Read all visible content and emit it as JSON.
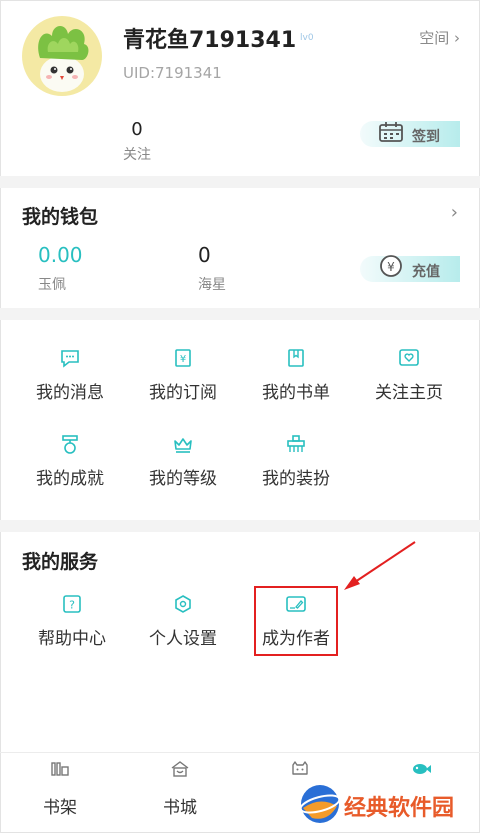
{
  "profile": {
    "username": "青花鱼7191341",
    "level_badge": "lv0",
    "uid": "UID:7191341",
    "space_label": "空间 ›",
    "follow_count": "0",
    "follow_label": "关注",
    "checkin_label": "签到"
  },
  "wallet": {
    "title": "我的钱包",
    "yupei_value": "0.00",
    "yupei_label": "玉佩",
    "haixing_value": "0",
    "haixing_label": "海星",
    "recharge_label": "充值"
  },
  "menu": {
    "messages": "我的消息",
    "subscriptions": "我的订阅",
    "booklists": "我的书单",
    "follow_home": "关注主页",
    "achievements": "我的成就",
    "level": "我的等级",
    "dress_up": "我的装扮"
  },
  "services": {
    "title": "我的服务",
    "help": "帮助中心",
    "settings": "个人设置",
    "become_author": "成为作者"
  },
  "nav": {
    "bookshelf": "书架",
    "bookstore": "书城"
  },
  "watermark": {
    "text": "经典软件园"
  },
  "colors": {
    "accent": "#28bfc0",
    "annotation_red": "#e32020"
  }
}
